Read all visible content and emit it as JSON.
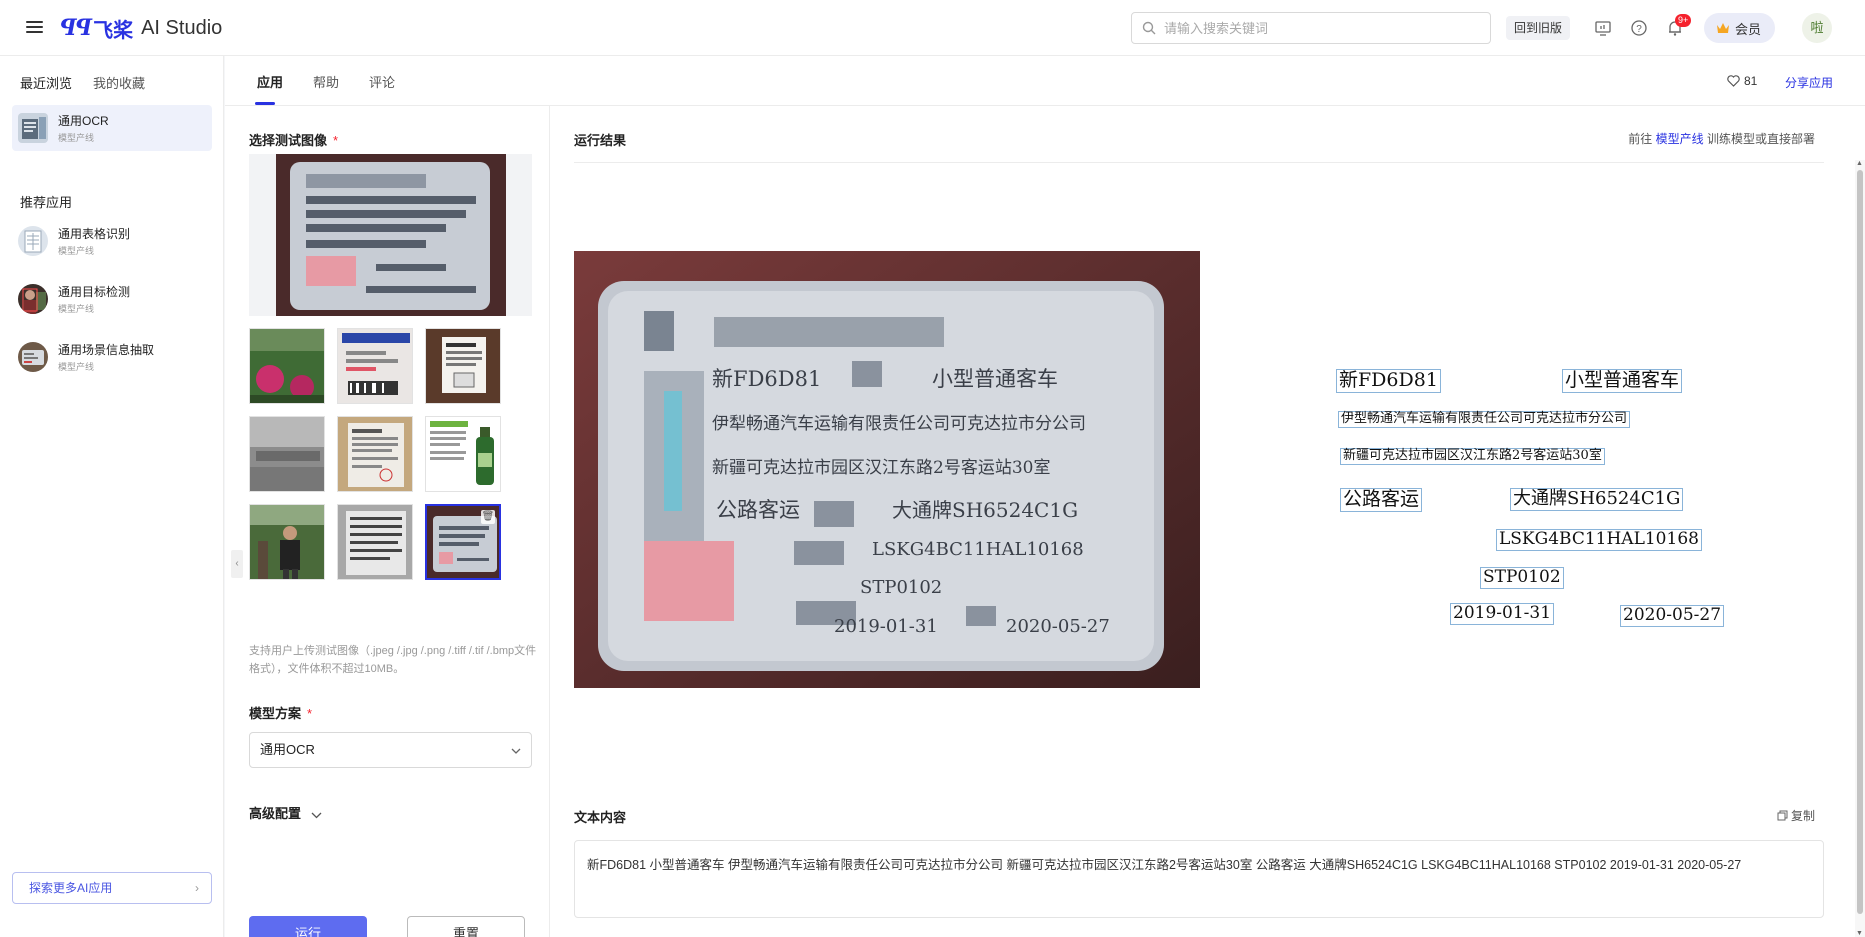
{
  "header": {
    "logo_cn": "飞桨",
    "logo_text": "AI Studio",
    "search_placeholder": "请输入搜索关键词",
    "old_version": "回到旧版",
    "notification_badge": "9+",
    "vip_label": "会员",
    "avatar_text": "啦"
  },
  "sidebar": {
    "tabs": [
      "最近浏览",
      "我的收藏"
    ],
    "recent": [
      {
        "name": "通用OCR",
        "sub": "模型产线"
      }
    ],
    "recommend_title": "推荐应用",
    "recommend": [
      {
        "name": "通用表格识别",
        "sub": "模型产线"
      },
      {
        "name": "通用目标检测",
        "sub": "模型产线"
      },
      {
        "name": "通用场景信息抽取",
        "sub": "模型产线"
      }
    ],
    "explore_more": "探索更多AI应用",
    "explore_arrow": "›"
  },
  "main": {
    "tabs": [
      "应用",
      "帮助",
      "评论"
    ],
    "likes": "81",
    "share": "分享应用"
  },
  "config": {
    "select_image_title": "选择测试图像",
    "required_mark": "*",
    "hint": "支持用户上传测试图像（.jpeg /.jpg /.png /.tiff /.tif /.bmp文件格式），文件体积不超过10MB。",
    "model_title": "模型方案",
    "model_value": "通用OCR",
    "advanced": "高级配置",
    "run": "运行",
    "reset": "重置"
  },
  "results": {
    "title": "运行结果",
    "link_prefix": "前往",
    "link_text": "模型产线",
    "link_suffix": "训练模型或直接部署",
    "text_content_title": "文本内容",
    "copy": "复制",
    "text_content": "新FD6D81 小型普通客车 伊型畅通汽车运输有限责任公司可克达拉市分公司 新疆可克达拉市园区汉江东路2号客运站30室 公路客运 大通牌SH6524C1G LSKG4BC11HAL10168 STP0102 2019-01-31 2020-05-27",
    "card_text": {
      "plate": "新FD6D81",
      "type": "小型普通客车",
      "company": "伊犁畅通汽车运输有限责任公司可克达拉市分公司",
      "address": "新疆可克达拉市园区汉江东路2号客运站30室",
      "use": "公路客运",
      "brand": "大通牌SH6524C1G",
      "vin": "LSKG4BC11HAL10168",
      "code": "STP0102",
      "date1": "2019-01-31",
      "date2": "2020-05-27"
    },
    "ocr": {
      "plate": "新FD6D81",
      "type": "小型普通客车",
      "company": "伊型畅通汽车运输有限责任公司可克达拉市分公司",
      "address": "新疆可克达拉市园区汉江东路2号客运站30室",
      "use": "公路客运",
      "brand": "大通牌SH6524C1G",
      "vin": "LSKG4BC11HAL10168",
      "code": "STP0102",
      "date1": "2019-01-31",
      "date2": "2020-05-27"
    }
  },
  "colors": {
    "brand": "#2932e1",
    "run_button": "#5e6cf0",
    "required": "#f5222d"
  }
}
